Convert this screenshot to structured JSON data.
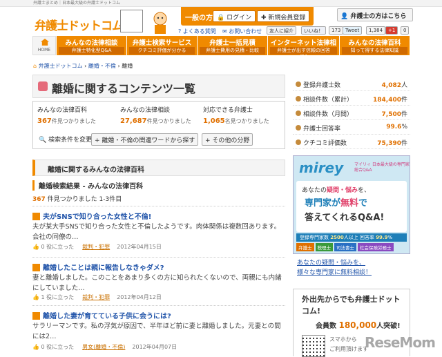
{
  "topbar": "弁護士まとめ｜日本最大級の弁護士ドットコム",
  "logo": {
    "text": "弁護士ドットコム"
  },
  "header": {
    "member_label": "一般の方",
    "login": "ログイン",
    "register": "新規会員登録",
    "lawyer_button": "弁護士の方はこちら",
    "faq": "よくある質問",
    "contact": "お問い合わせ",
    "friends": "友人に紹介",
    "like": "いいね！",
    "like_count": "173",
    "tweet": "Tweet",
    "tweet_count": "1,384",
    "gplus": "+1",
    "gplus_count": "0"
  },
  "nav": {
    "home": "HOME",
    "items": [
      {
        "title": "みんなの法律相談",
        "sub": "弁護士特化型Q&A"
      },
      {
        "title": "弁護士検索サービス",
        "sub": "クチコミ評価が分かる"
      },
      {
        "title": "弁護士一括見積",
        "sub": "弁護士費用の見積・比較"
      },
      {
        "title": "インターネット法律相談",
        "sub": "弁護士が出す信頼の回答"
      },
      {
        "title": "みんなの法律百科",
        "sub": "知って得する法律知識"
      }
    ]
  },
  "breadcrumb": {
    "home": "弁護士ドットコム",
    "cat": "離婚・不倫",
    "current": "離婚"
  },
  "page_title": "離婚に関するコンテンツ一覧",
  "stats": [
    {
      "label": "みんなの法律百科",
      "value": "367",
      "unit": "件見つかりました"
    },
    {
      "label": "みんなの法律相談",
      "value": "27,687",
      "unit": "件見つかりました"
    },
    {
      "label": "対応できる弁護士",
      "value": "1,065",
      "unit": "名見つかりました"
    }
  ],
  "controls": {
    "change": "検索条件を変更",
    "related": "離婚・不倫の関連ワードから探す",
    "other": "その他の分野"
  },
  "section": {
    "title": "離婚に関するみんなの法律百科",
    "subtitle": "離婚検索結果 - みんなの法律百科",
    "count": "367",
    "count_text": "件見つかりました 1-3件目"
  },
  "articles": [
    {
      "title": "夫がSNSで知り合った女性と不倫!",
      "body": "夫が某大手SNSで知り合った女性と不倫したようです。肉体関係は複数回あります。会社の同僚の…",
      "helpful": "0",
      "helpful_label": "役に立った",
      "category": "裁判・犯罪",
      "date": "2012年04月15日"
    },
    {
      "title": "離婚したことは親に報告しなきゃダメ?",
      "body": "妻と離婚しました。このことをあまり多くの方に知られたくないので、両親にも内緒にしていました…",
      "helpful": "1",
      "helpful_label": "役に立った",
      "category": "裁判・犯罪",
      "date": "2012年04月12日"
    },
    {
      "title": "離婚した妻が育てている子供に会うには?",
      "body": "サラリーマンです。私の浮気が原因で、半年ほど前に妻と離婚しました。元妻との間には2…",
      "helpful": "0",
      "helpful_label": "役に立った",
      "category": "男女(離婚・不倫)",
      "date": "2012年04月07日"
    }
  ],
  "sidebar": {
    "stats": [
      {
        "label": "登録弁護士数",
        "value": "4,082",
        "unit": "人"
      },
      {
        "label": "相談件数（累計）",
        "value": "184,400",
        "unit": "件"
      },
      {
        "label": "相談件数（月間）",
        "value": "7,500",
        "unit": "件"
      },
      {
        "label": "弁護士回答率",
        "value": "99.6",
        "unit": "%"
      },
      {
        "label": "クチコミ評価数",
        "value": "75,390",
        "unit": "件"
      }
    ],
    "ad": {
      "brand": "mirey",
      "tagline": "マイリィ 日本最大級の専門家総合Q&A",
      "line1a": "あなたの",
      "line1b": "疑問・悩み",
      "line1c": "を、",
      "line2a": "専門家が",
      "line2b": "無料",
      "line2c": "で",
      "line3": "答えてくれるQ&A!",
      "band_a": "登録専門家数",
      "band_b": "2500",
      "band_c": "人以上 回答率",
      "band_d": "99.9",
      "band_e": "%",
      "tags": [
        "弁護士",
        "税理士",
        "司法書士",
        "社会保険労務士"
      ]
    },
    "links": [
      "あなたの疑問・悩みを、",
      "様々な専門家に無料相談！"
    ],
    "promo": {
      "title": "外出先からでも弁護士ドットコム!",
      "members_a": "会員数",
      "members_b": "180,000",
      "members_c": "人突破!",
      "mobile1": "スマホから",
      "mobile2": "ご利用頂けます"
    }
  },
  "watermark": "ReseMom"
}
